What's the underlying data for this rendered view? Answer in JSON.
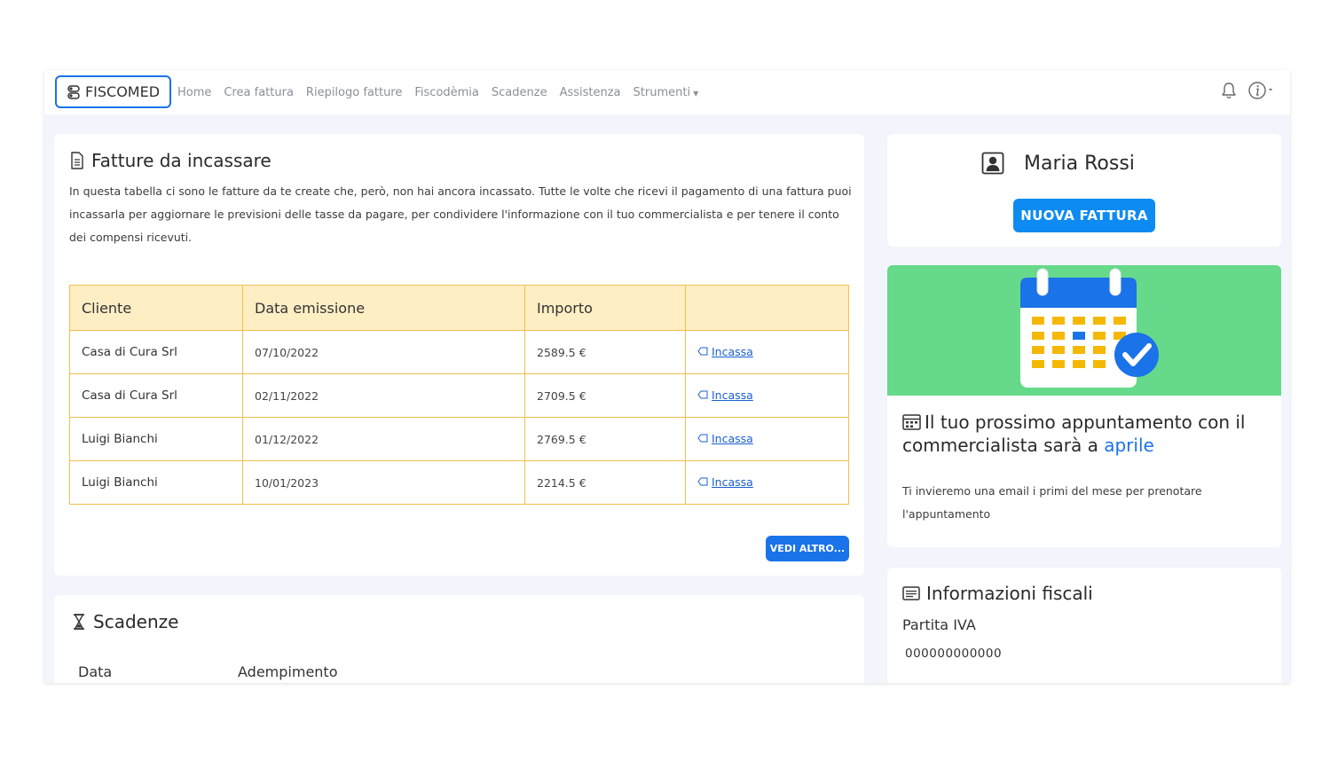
{
  "navbar": {
    "brand": "FISCOMED",
    "links": [
      "Home",
      "Crea fattura",
      "Riepilogo fatture",
      "Fiscodèmia",
      "Scadenze",
      "Assistenza",
      "Strumenti"
    ],
    "icons": [
      "bell-icon",
      "info-icon"
    ]
  },
  "invoices": {
    "title": "Fatture da incassare",
    "description": "In questa tabella ci sono le fatture da te create che, però, non hai ancora incassato. Tutte le volte che ricevi il pagamento di una fattura puoi incassarla per aggiornare le previsioni delle tasse da pagare, per condividere l'informazione con il tuo commercialista e per tenere il conto dei compensi ricevuti.",
    "columns": [
      "Cliente",
      "Data emissione",
      "Importo",
      ""
    ],
    "rows": [
      {
        "cliente": "Casa di Cura Srl",
        "data": "07/10/2022",
        "importo": "2589.5 €",
        "action": "Incassa"
      },
      {
        "cliente": "Casa di Cura Srl",
        "data": "02/11/2022",
        "importo": "2709.5 €",
        "action": "Incassa"
      },
      {
        "cliente": "Luigi Bianchi",
        "data": "01/12/2022",
        "importo": "2769.5 €",
        "action": "Incassa"
      },
      {
        "cliente": "Luigi Bianchi",
        "data": "10/01/2023",
        "importo": "2214.5 €",
        "action": "Incassa"
      }
    ],
    "more_button": "VEDI ALTRO..."
  },
  "scadenze": {
    "title": "Scadenze",
    "col_data": "Data",
    "col_adempimento": "Adempimento"
  },
  "profile": {
    "name": "Maria Rossi",
    "new_invoice_button": "NUOVA FATTURA"
  },
  "appointment": {
    "title_prefix": "Il tuo prossimo appuntamento con il commercialista sarà a ",
    "month": "aprile",
    "text": "Ti invieremo una email i primi del mese per prenotare l'appuntamento"
  },
  "fiscal": {
    "title": "Informazioni fiscali",
    "partita_iva_label": "Partita IVA",
    "partita_iva_value": "000000000000"
  },
  "colors": {
    "primary": "#1a73e8",
    "table_header_bg": "#fdeec4",
    "table_border": "#f2c04b",
    "banner_green": "#66d98a",
    "background": "#f2f5fb"
  }
}
